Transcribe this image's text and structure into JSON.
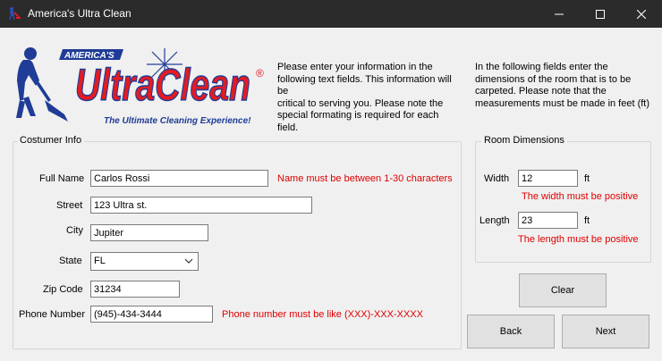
{
  "window": {
    "title": "America's Ultra Clean",
    "app_icon": "vacuum-cleaner-icon"
  },
  "logo": {
    "brand_top": "AMERICA'S",
    "brand_main": "UltraClean",
    "registered": "®",
    "tagline": "The Ultimate Cleaning Experience!",
    "brand_red": "#e31b23",
    "brand_blue": "#1f3c96"
  },
  "instructions": {
    "left": "Please enter your information in the\nfollowing text fields. This information will be\ncritical to serving you. Please note the\nspecial formating is required for each field.",
    "right": "In the following fields enter the\ndimensions of the room that is to be\ncarpeted. Please note that the\nmeasurements must be made in feet (ft)"
  },
  "customer": {
    "group_label": "Costumer Info",
    "full_name": {
      "label": "Full Name",
      "value": "Carlos Rossi",
      "error": "Name must be between 1-30 characters"
    },
    "street": {
      "label": "Street",
      "value": "123 Ultra st."
    },
    "city": {
      "label": "City",
      "value": "Jupiter"
    },
    "state": {
      "label": "State",
      "value": "FL"
    },
    "zip": {
      "label": "Zip Code",
      "value": "31234"
    },
    "phone": {
      "label": "Phone Number",
      "value": "(945)-434-3444",
      "error": "Phone number must be like (XXX)-XXX-XXXX"
    }
  },
  "room": {
    "group_label": "Room Dimensions",
    "width": {
      "label": "Width",
      "value": "12",
      "unit": "ft",
      "error": "The width must be positive"
    },
    "length": {
      "label": "Length",
      "value": "23",
      "unit": "ft",
      "error": "The length must be positive"
    }
  },
  "buttons": {
    "clear": "Clear",
    "back": "Back",
    "next": "Next"
  },
  "colors": {
    "error": "#e00000",
    "titlebar": "#2b2b2b"
  }
}
